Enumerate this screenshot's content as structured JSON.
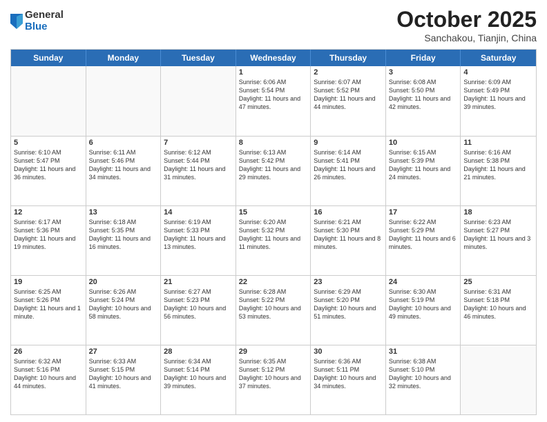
{
  "header": {
    "logo_general": "General",
    "logo_blue": "Blue",
    "month": "October 2025",
    "location": "Sanchakou, Tianjin, China"
  },
  "days_of_week": [
    "Sunday",
    "Monday",
    "Tuesday",
    "Wednesday",
    "Thursday",
    "Friday",
    "Saturday"
  ],
  "weeks": [
    [
      {
        "day": "",
        "empty": true
      },
      {
        "day": "",
        "empty": true
      },
      {
        "day": "",
        "empty": true
      },
      {
        "day": "1",
        "sunrise": "6:06 AM",
        "sunset": "5:54 PM",
        "daylight": "11 hours and 47 minutes."
      },
      {
        "day": "2",
        "sunrise": "6:07 AM",
        "sunset": "5:52 PM",
        "daylight": "11 hours and 44 minutes."
      },
      {
        "day": "3",
        "sunrise": "6:08 AM",
        "sunset": "5:50 PM",
        "daylight": "11 hours and 42 minutes."
      },
      {
        "day": "4",
        "sunrise": "6:09 AM",
        "sunset": "5:49 PM",
        "daylight": "11 hours and 39 minutes."
      }
    ],
    [
      {
        "day": "5",
        "sunrise": "6:10 AM",
        "sunset": "5:47 PM",
        "daylight": "11 hours and 36 minutes."
      },
      {
        "day": "6",
        "sunrise": "6:11 AM",
        "sunset": "5:46 PM",
        "daylight": "11 hours and 34 minutes."
      },
      {
        "day": "7",
        "sunrise": "6:12 AM",
        "sunset": "5:44 PM",
        "daylight": "11 hours and 31 minutes."
      },
      {
        "day": "8",
        "sunrise": "6:13 AM",
        "sunset": "5:42 PM",
        "daylight": "11 hours and 29 minutes."
      },
      {
        "day": "9",
        "sunrise": "6:14 AM",
        "sunset": "5:41 PM",
        "daylight": "11 hours and 26 minutes."
      },
      {
        "day": "10",
        "sunrise": "6:15 AM",
        "sunset": "5:39 PM",
        "daylight": "11 hours and 24 minutes."
      },
      {
        "day": "11",
        "sunrise": "6:16 AM",
        "sunset": "5:38 PM",
        "daylight": "11 hours and 21 minutes."
      }
    ],
    [
      {
        "day": "12",
        "sunrise": "6:17 AM",
        "sunset": "5:36 PM",
        "daylight": "11 hours and 19 minutes."
      },
      {
        "day": "13",
        "sunrise": "6:18 AM",
        "sunset": "5:35 PM",
        "daylight": "11 hours and 16 minutes."
      },
      {
        "day": "14",
        "sunrise": "6:19 AM",
        "sunset": "5:33 PM",
        "daylight": "11 hours and 13 minutes."
      },
      {
        "day": "15",
        "sunrise": "6:20 AM",
        "sunset": "5:32 PM",
        "daylight": "11 hours and 11 minutes."
      },
      {
        "day": "16",
        "sunrise": "6:21 AM",
        "sunset": "5:30 PM",
        "daylight": "11 hours and 8 minutes."
      },
      {
        "day": "17",
        "sunrise": "6:22 AM",
        "sunset": "5:29 PM",
        "daylight": "11 hours and 6 minutes."
      },
      {
        "day": "18",
        "sunrise": "6:23 AM",
        "sunset": "5:27 PM",
        "daylight": "11 hours and 3 minutes."
      }
    ],
    [
      {
        "day": "19",
        "sunrise": "6:25 AM",
        "sunset": "5:26 PM",
        "daylight": "11 hours and 1 minute."
      },
      {
        "day": "20",
        "sunrise": "6:26 AM",
        "sunset": "5:24 PM",
        "daylight": "10 hours and 58 minutes."
      },
      {
        "day": "21",
        "sunrise": "6:27 AM",
        "sunset": "5:23 PM",
        "daylight": "10 hours and 56 minutes."
      },
      {
        "day": "22",
        "sunrise": "6:28 AM",
        "sunset": "5:22 PM",
        "daylight": "10 hours and 53 minutes."
      },
      {
        "day": "23",
        "sunrise": "6:29 AM",
        "sunset": "5:20 PM",
        "daylight": "10 hours and 51 minutes."
      },
      {
        "day": "24",
        "sunrise": "6:30 AM",
        "sunset": "5:19 PM",
        "daylight": "10 hours and 49 minutes."
      },
      {
        "day": "25",
        "sunrise": "6:31 AM",
        "sunset": "5:18 PM",
        "daylight": "10 hours and 46 minutes."
      }
    ],
    [
      {
        "day": "26",
        "sunrise": "6:32 AM",
        "sunset": "5:16 PM",
        "daylight": "10 hours and 44 minutes."
      },
      {
        "day": "27",
        "sunrise": "6:33 AM",
        "sunset": "5:15 PM",
        "daylight": "10 hours and 41 minutes."
      },
      {
        "day": "28",
        "sunrise": "6:34 AM",
        "sunset": "5:14 PM",
        "daylight": "10 hours and 39 minutes."
      },
      {
        "day": "29",
        "sunrise": "6:35 AM",
        "sunset": "5:12 PM",
        "daylight": "10 hours and 37 minutes."
      },
      {
        "day": "30",
        "sunrise": "6:36 AM",
        "sunset": "5:11 PM",
        "daylight": "10 hours and 34 minutes."
      },
      {
        "day": "31",
        "sunrise": "6:38 AM",
        "sunset": "5:10 PM",
        "daylight": "10 hours and 32 minutes."
      },
      {
        "day": "",
        "empty": true
      }
    ]
  ]
}
